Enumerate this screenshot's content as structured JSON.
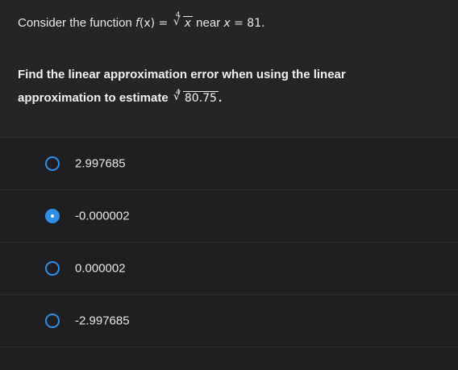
{
  "question": {
    "intro_prefix": "Consider the function ",
    "func_name": "f",
    "func_arg": "(x) = ",
    "root_index": "4",
    "root_radicand": "x",
    "intro_mid": " near ",
    "var": "x",
    "intro_eq": " = 81.",
    "main_line1": "Find the linear approximation error when using the linear",
    "main_line2_prefix": "approximation to estimate ",
    "estimate_index": "4",
    "estimate_radicand": "80.75",
    "main_line2_suffix": "."
  },
  "options": [
    {
      "label": "2.997685",
      "selected": false
    },
    {
      "label": "-0.000002",
      "selected": true
    },
    {
      "label": "0.000002",
      "selected": false
    },
    {
      "label": "-2.997685",
      "selected": false
    }
  ],
  "colors": {
    "accent": "#2f8ee6",
    "background": "#1f1f21",
    "panel": "#252527"
  }
}
